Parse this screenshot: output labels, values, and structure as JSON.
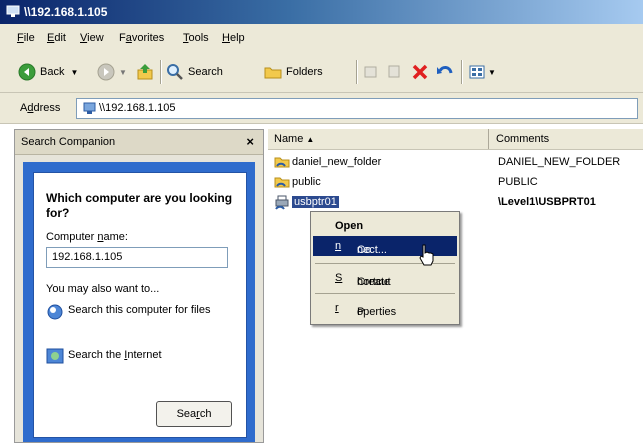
{
  "window": {
    "title": "\\\\192.168.1.105"
  },
  "menu": [
    {
      "pre": "",
      "ul": "F",
      "post": "ile"
    },
    {
      "pre": "",
      "ul": "E",
      "post": "dit"
    },
    {
      "pre": "",
      "ul": "V",
      "post": "iew"
    },
    {
      "pre": "F",
      "ul": "a",
      "post": "vorites"
    },
    {
      "pre": "",
      "ul": "T",
      "post": "ools"
    },
    {
      "pre": "",
      "ul": "H",
      "post": "elp"
    }
  ],
  "toolbar": {
    "back": "Back",
    "search": "Search",
    "folders": "Folders"
  },
  "address": {
    "label_pre": "A",
    "label_ul": "d",
    "label_post": "dress",
    "value": "\\\\192.168.1.105"
  },
  "left_pane": {
    "title": "Search Companion",
    "close": "×",
    "question": "Which computer are you looking for?",
    "computer_name_pre": "Computer ",
    "computer_name_ul": "n",
    "computer_name_post": "ame:",
    "computer_name_value": "192.168.1.105",
    "also": "You may also want to...",
    "option1": "Search this computer for files",
    "option2_pre": "Search the ",
    "option2_ul": "I",
    "option2_post": "nternet",
    "search_pre": "Sea",
    "search_ul": "r",
    "search_post": "ch"
  },
  "list": {
    "col_name": "Name",
    "col_comments": "Comments",
    "rows": [
      {
        "name": "daniel_new_folder",
        "comment": "DANIEL_NEW_FOLDER"
      },
      {
        "name": "public",
        "comment": "PUBLIC"
      },
      {
        "name": "usbptr01",
        "comment": "\\Level1\\USBPRT01"
      }
    ]
  },
  "context_menu": {
    "open": "Open",
    "connect_pre": "Co",
    "connect_ul": "n",
    "connect_post": "nect...",
    "create_shortcut_pre": "Create ",
    "create_shortcut_ul": "S",
    "create_shortcut_post": "hortcut",
    "properties_pre": "P",
    "properties_ul": "r",
    "properties_post": "operties"
  }
}
